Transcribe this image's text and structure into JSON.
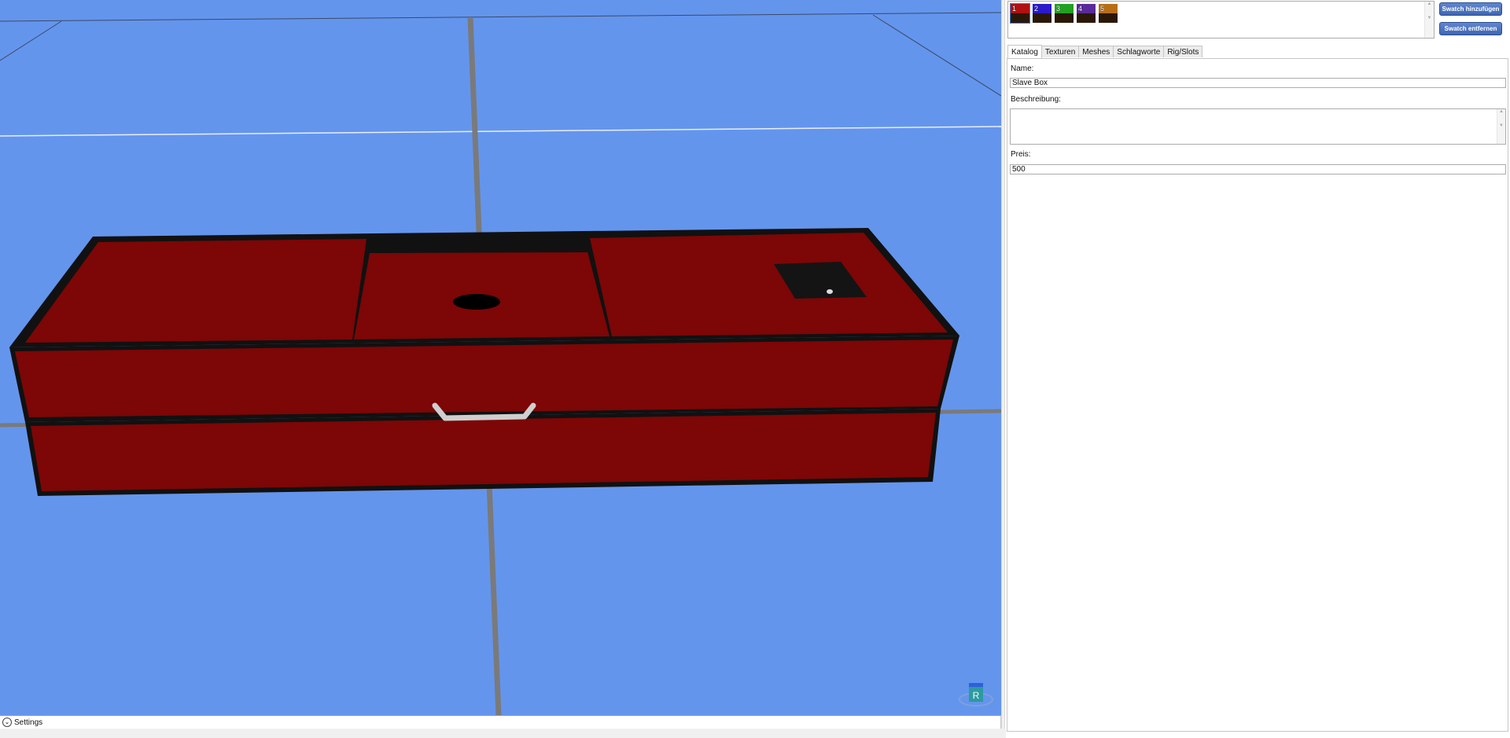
{
  "viewport": {
    "gizmo_label": "R"
  },
  "settings_bar": {
    "label": "Settings",
    "chevron": "chevron-down-icon"
  },
  "swatches": [
    {
      "number": "1",
      "color": "#b01010",
      "selected": true
    },
    {
      "number": "2",
      "color": "#2a1acb",
      "selected": false
    },
    {
      "number": "3",
      "color": "#22a022",
      "selected": false
    },
    {
      "number": "4",
      "color": "#5a2a9a",
      "selected": false
    },
    {
      "number": "5",
      "color": "#b86e14",
      "selected": false
    }
  ],
  "buttons": {
    "add_swatch": "Swatch hinzufügen",
    "remove_swatch": "Swatch entfernen"
  },
  "tabs": [
    {
      "label": "Katalog",
      "active": true
    },
    {
      "label": "Texturen",
      "active": false
    },
    {
      "label": "Meshes",
      "active": false
    },
    {
      "label": "Schlagworte",
      "active": false
    },
    {
      "label": "Rig/Slots",
      "active": false
    }
  ],
  "form": {
    "name_label": "Name:",
    "name_value": "Slave Box",
    "description_label": "Beschreibung:",
    "description_value": "",
    "price_label": "Preis:",
    "price_value": "500"
  },
  "colors": {
    "sky": "#6495ed",
    "box_red": "#7d0606",
    "button_blue": "#4a70be"
  }
}
